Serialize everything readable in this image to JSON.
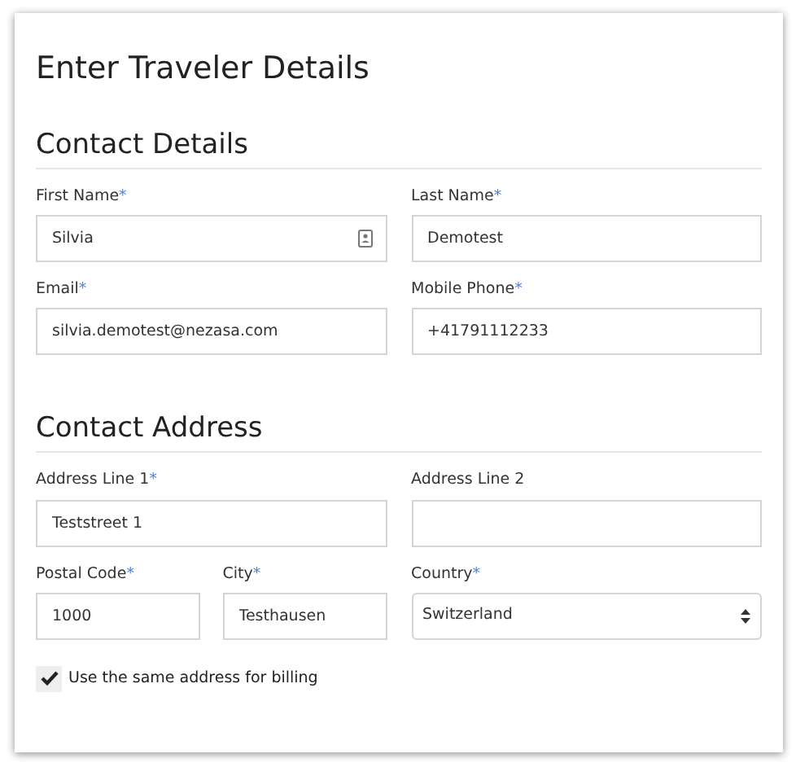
{
  "title": "Enter Traveler Details",
  "sections": [
    {
      "heading": "Contact Details",
      "rows": [
        [
          [
            {
              "kind": "text",
              "label": "First Name",
              "required_mark": "*",
              "value": "Silvia",
              "autofill_icon": true
            }
          ],
          [
            {
              "kind": "text",
              "label": "Last Name",
              "required_mark": "*",
              "value": "Demotest"
            }
          ]
        ],
        [
          [
            {
              "kind": "text",
              "label": "Email",
              "required_mark": "*",
              "value": "silvia.demotest@nezasa.com"
            }
          ],
          [
            {
              "kind": "text",
              "label": "Mobile Phone",
              "required_mark": "*",
              "value": "+41791112233"
            }
          ]
        ]
      ]
    },
    {
      "heading": "Contact Address",
      "rows": [
        [
          [
            {
              "kind": "text",
              "label": "Address Line 1",
              "required_mark": "*",
              "value": "Teststreet 1"
            }
          ],
          [
            {
              "kind": "text",
              "label": "Address Line 2"
            }
          ]
        ],
        [
          [
            {
              "kind": "text",
              "label": "Postal Code",
              "required_mark": "*",
              "value": "1000"
            },
            {
              "kind": "text",
              "label": "City",
              "required_mark": "*",
              "value": "Testhausen"
            }
          ],
          [
            {
              "kind": "select",
              "label": "Country",
              "required_mark": "*",
              "value": "Switzerland"
            }
          ]
        ]
      ]
    }
  ],
  "billing_checkbox": {
    "label": "Use the same address for billing",
    "checked": true
  }
}
